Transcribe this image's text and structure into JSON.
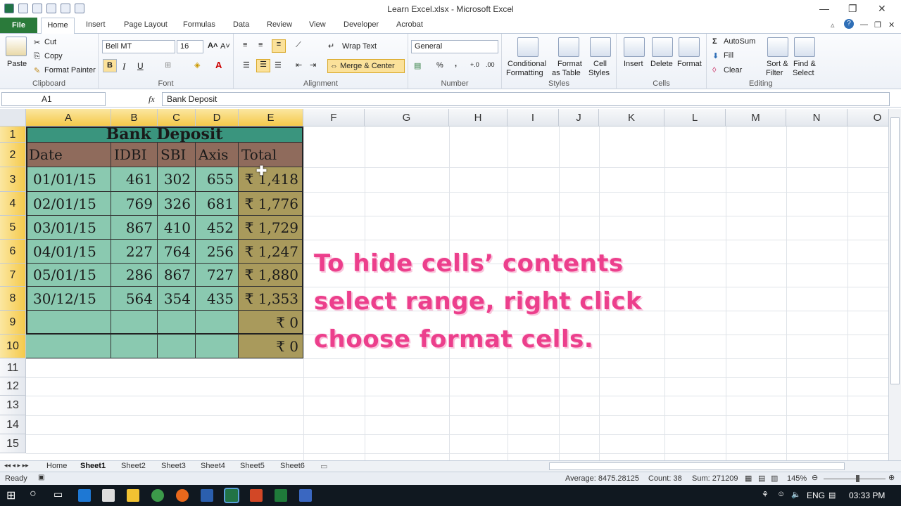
{
  "window": {
    "title": "Learn Excel.xlsx  -  Microsoft Excel"
  },
  "ribbon_tabs": [
    "File",
    "Home",
    "Insert",
    "Page Layout",
    "Formulas",
    "Data",
    "Review",
    "View",
    "Developer",
    "Acrobat"
  ],
  "clipboard": {
    "paste": "Paste",
    "cut": "Cut",
    "copy": "Copy",
    "format_painter": "Format Painter",
    "label": "Clipboard"
  },
  "font": {
    "name": "Bell MT",
    "size": "16",
    "bold": "B",
    "italic": "I",
    "underline": "U",
    "label": "Font"
  },
  "alignment": {
    "wrap": "Wrap Text",
    "merge": "Merge & Center",
    "label": "Alignment"
  },
  "number": {
    "format": "General",
    "percent": "%",
    "comma": ",",
    "label": "Number"
  },
  "styles": {
    "conditional_1": "Conditional",
    "conditional_2": "Formatting",
    "format_table_1": "Format",
    "format_table_2": "as Table",
    "cell_styles_1": "Cell",
    "cell_styles_2": "Styles",
    "label": "Styles"
  },
  "cells": {
    "insert": "Insert",
    "delete": "Delete",
    "format": "Format",
    "label": "Cells"
  },
  "editing": {
    "autosum": "AutoSum",
    "fill": "Fill",
    "clear": "Clear",
    "sort_1": "Sort &",
    "sort_2": "Filter",
    "find_1": "Find &",
    "find_2": "Select",
    "label": "Editing"
  },
  "formula_bar": {
    "name_box": "A1",
    "fx": "fx",
    "content": "Bank Deposit"
  },
  "columns": [
    "A",
    "B",
    "C",
    "D",
    "E",
    "F",
    "G",
    "H",
    "I",
    "J",
    "K",
    "L",
    "M",
    "N",
    "O"
  ],
  "rows": [
    "1",
    "2",
    "3",
    "4",
    "5",
    "6",
    "7",
    "8",
    "9",
    "10",
    "11",
    "12",
    "13",
    "14",
    "15"
  ],
  "table": {
    "title": "Bank Deposit",
    "headers": [
      "Date",
      "IDBI",
      "SBI",
      "Axis",
      "Total"
    ],
    "data": [
      [
        "01/01/15",
        "461",
        "302",
        "655",
        "₹ 1,418"
      ],
      [
        "02/01/15",
        "769",
        "326",
        "681",
        "₹ 1,776"
      ],
      [
        "03/01/15",
        "867",
        "410",
        "452",
        "₹ 1,729"
      ],
      [
        "04/01/15",
        "227",
        "764",
        "256",
        "₹ 1,247"
      ],
      [
        "05/01/15",
        "286",
        "867",
        "727",
        "₹ 1,880"
      ],
      [
        "30/12/15",
        "564",
        "354",
        "435",
        "₹ 1,353"
      ],
      [
        "",
        "",
        "",
        "",
        "₹ 0"
      ],
      [
        "",
        "",
        "",
        "",
        "₹ 0"
      ]
    ]
  },
  "overlay": {
    "line1": "To  hide  cells’  contents",
    "line2": "select range, right click",
    "line3": "choose format cells."
  },
  "sheets": [
    "Home",
    "Sheet1",
    "Sheet2",
    "Sheet3",
    "Sheet4",
    "Sheet5",
    "Sheet6"
  ],
  "status": {
    "ready": "Ready",
    "average": "Average: 8475.28125",
    "count": "Count: 38",
    "sum": "Sum: 271209",
    "zoom": "145%"
  },
  "taskbar": {
    "lang": "ENG",
    "time": "03:33 PM"
  },
  "colors": {
    "title_fill": "#3a957e",
    "header_fill": "#8f6b5c",
    "data_fill": "#8ac9b0",
    "total_fill": "#a99a5c",
    "overlay": "#ec3f8c",
    "file_tab": "#2a7a3a"
  }
}
